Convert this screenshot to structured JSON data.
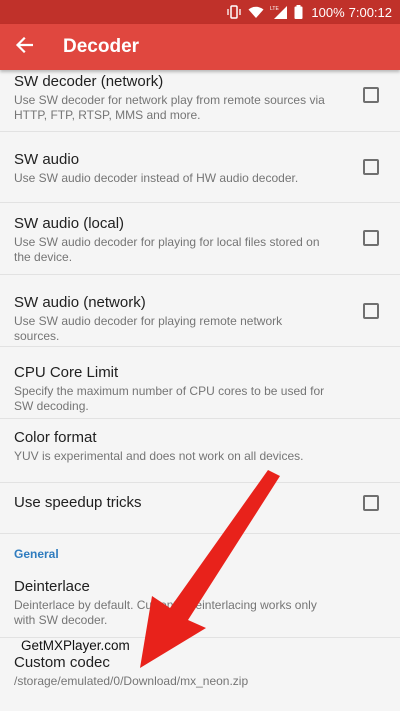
{
  "status_bar": {
    "battery_text": "100%",
    "time": "7:00:12",
    "network_label": "LTE"
  },
  "app_bar": {
    "title": "Decoder",
    "back_icon": "arrow-left-icon"
  },
  "settings": [
    {
      "title": "SW decoder (network)",
      "summary": "Use SW decoder for network play from remote sources via HTTP, FTP, RTSP, MMS and more.",
      "checkbox": true,
      "checked": false
    },
    {
      "title": "SW audio",
      "summary": "Use SW audio decoder instead of HW audio decoder.",
      "checkbox": true,
      "checked": false
    },
    {
      "title": "SW audio (local)",
      "summary": "Use SW audio decoder for playing for local files stored on the device.",
      "checkbox": true,
      "checked": false
    },
    {
      "title": "SW audio (network)",
      "summary": "Use SW audio decoder for playing remote network sources.",
      "checkbox": true,
      "checked": false
    },
    {
      "title": "CPU Core Limit",
      "summary": "Specify the maximum number of CPU cores to be used for SW decoding.",
      "checkbox": false
    },
    {
      "title": "Color format",
      "summary": "YUV is experimental and does not work on all devices.",
      "checkbox": false
    },
    {
      "title": "Use speedup tricks",
      "summary": "",
      "checkbox": true,
      "checked": false
    }
  ],
  "general": {
    "header": "General",
    "deinterlace": {
      "title": "Deinterlace",
      "summary": "Deinterlace by default. Currently deinterlacing works only with SW decoder."
    },
    "custom_codec": {
      "title": "Custom codec",
      "summary": "/storage/emulated/0/Download/mx_neon.zip"
    }
  },
  "watermark": "GetMXPlayer.com",
  "colors": {
    "status_bar": "#c0312a",
    "app_bar": "#e0473f",
    "accent_blue": "#2f7cbf",
    "arrow_red": "#e8221b"
  }
}
